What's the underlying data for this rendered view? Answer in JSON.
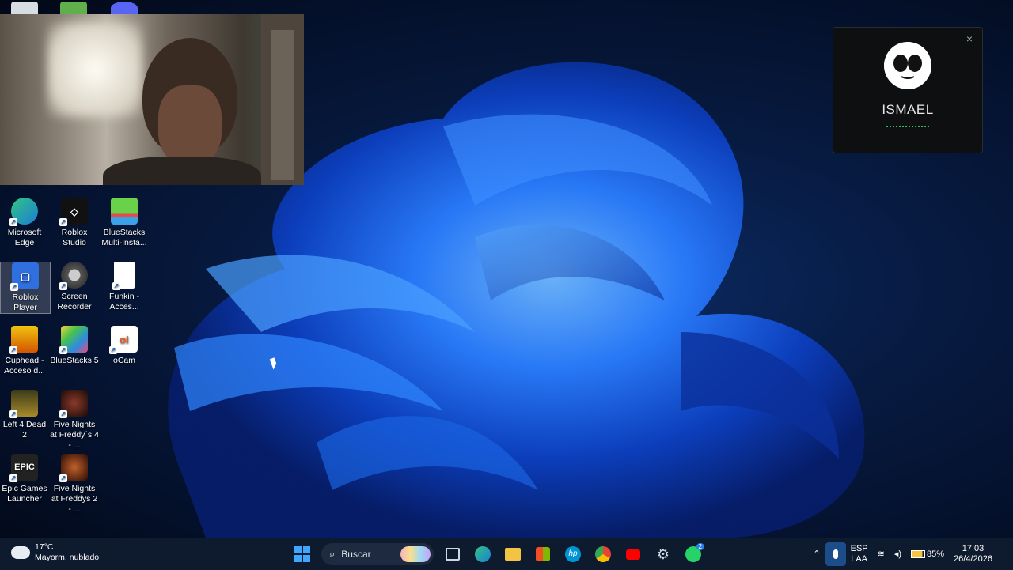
{
  "desktop": {
    "icons": [
      {
        "label": "Microsoft Edge",
        "icon": "edge-icon"
      },
      {
        "label": "Roblox Studio",
        "icon": "roblox-studio-icon"
      },
      {
        "label": "BlueStacks Multi-Insta...",
        "icon": "bluestacks-multi-icon"
      },
      {
        "label": "Roblox Player",
        "icon": "roblox-player-icon"
      },
      {
        "label": "Screen Recorder",
        "icon": "screen-recorder-icon"
      },
      {
        "label": "Funkin - Acces...",
        "icon": "file-icon"
      },
      {
        "label": "Cuphead - Acceso d...",
        "icon": "cuphead-icon"
      },
      {
        "label": "BlueStacks 5",
        "icon": "bluestacks-icon"
      },
      {
        "label": "oCam",
        "icon": "ocam-icon"
      },
      {
        "label": "Left 4 Dead 2",
        "icon": "left4dead-icon"
      },
      {
        "label": "Five Nights at Freddy´s 4 - ...",
        "icon": "fnaf4-icon"
      },
      {
        "label": "Epic Games Launcher",
        "icon": "epic-games-icon"
      },
      {
        "label": "Five Nights at Freddys 2 - ...",
        "icon": "fnaf2-icon"
      }
    ]
  },
  "notification": {
    "name": "ISMAEL",
    "close_icon": "×"
  },
  "taskbar": {
    "weather": {
      "temp": "17°C",
      "desc": "Mayorm. nublado"
    },
    "search_label": "Buscar",
    "pinned": [
      "windows-start-icon",
      "task-view-icon",
      "edge-icon",
      "file-explorer-icon",
      "microsoft-store-icon",
      "hp-icon",
      "chrome-icon",
      "youtube-icon",
      "settings-icon",
      "whatsapp-icon"
    ],
    "tray": {
      "language": "ESP",
      "layout": "LAA",
      "battery": "85%",
      "time": "17:03",
      "date": "26/4/2026",
      "whatsapp_badge": "2"
    }
  },
  "colors": {
    "accent": "#1a6ee0",
    "taskbar_bg": "#0e1a2e"
  }
}
